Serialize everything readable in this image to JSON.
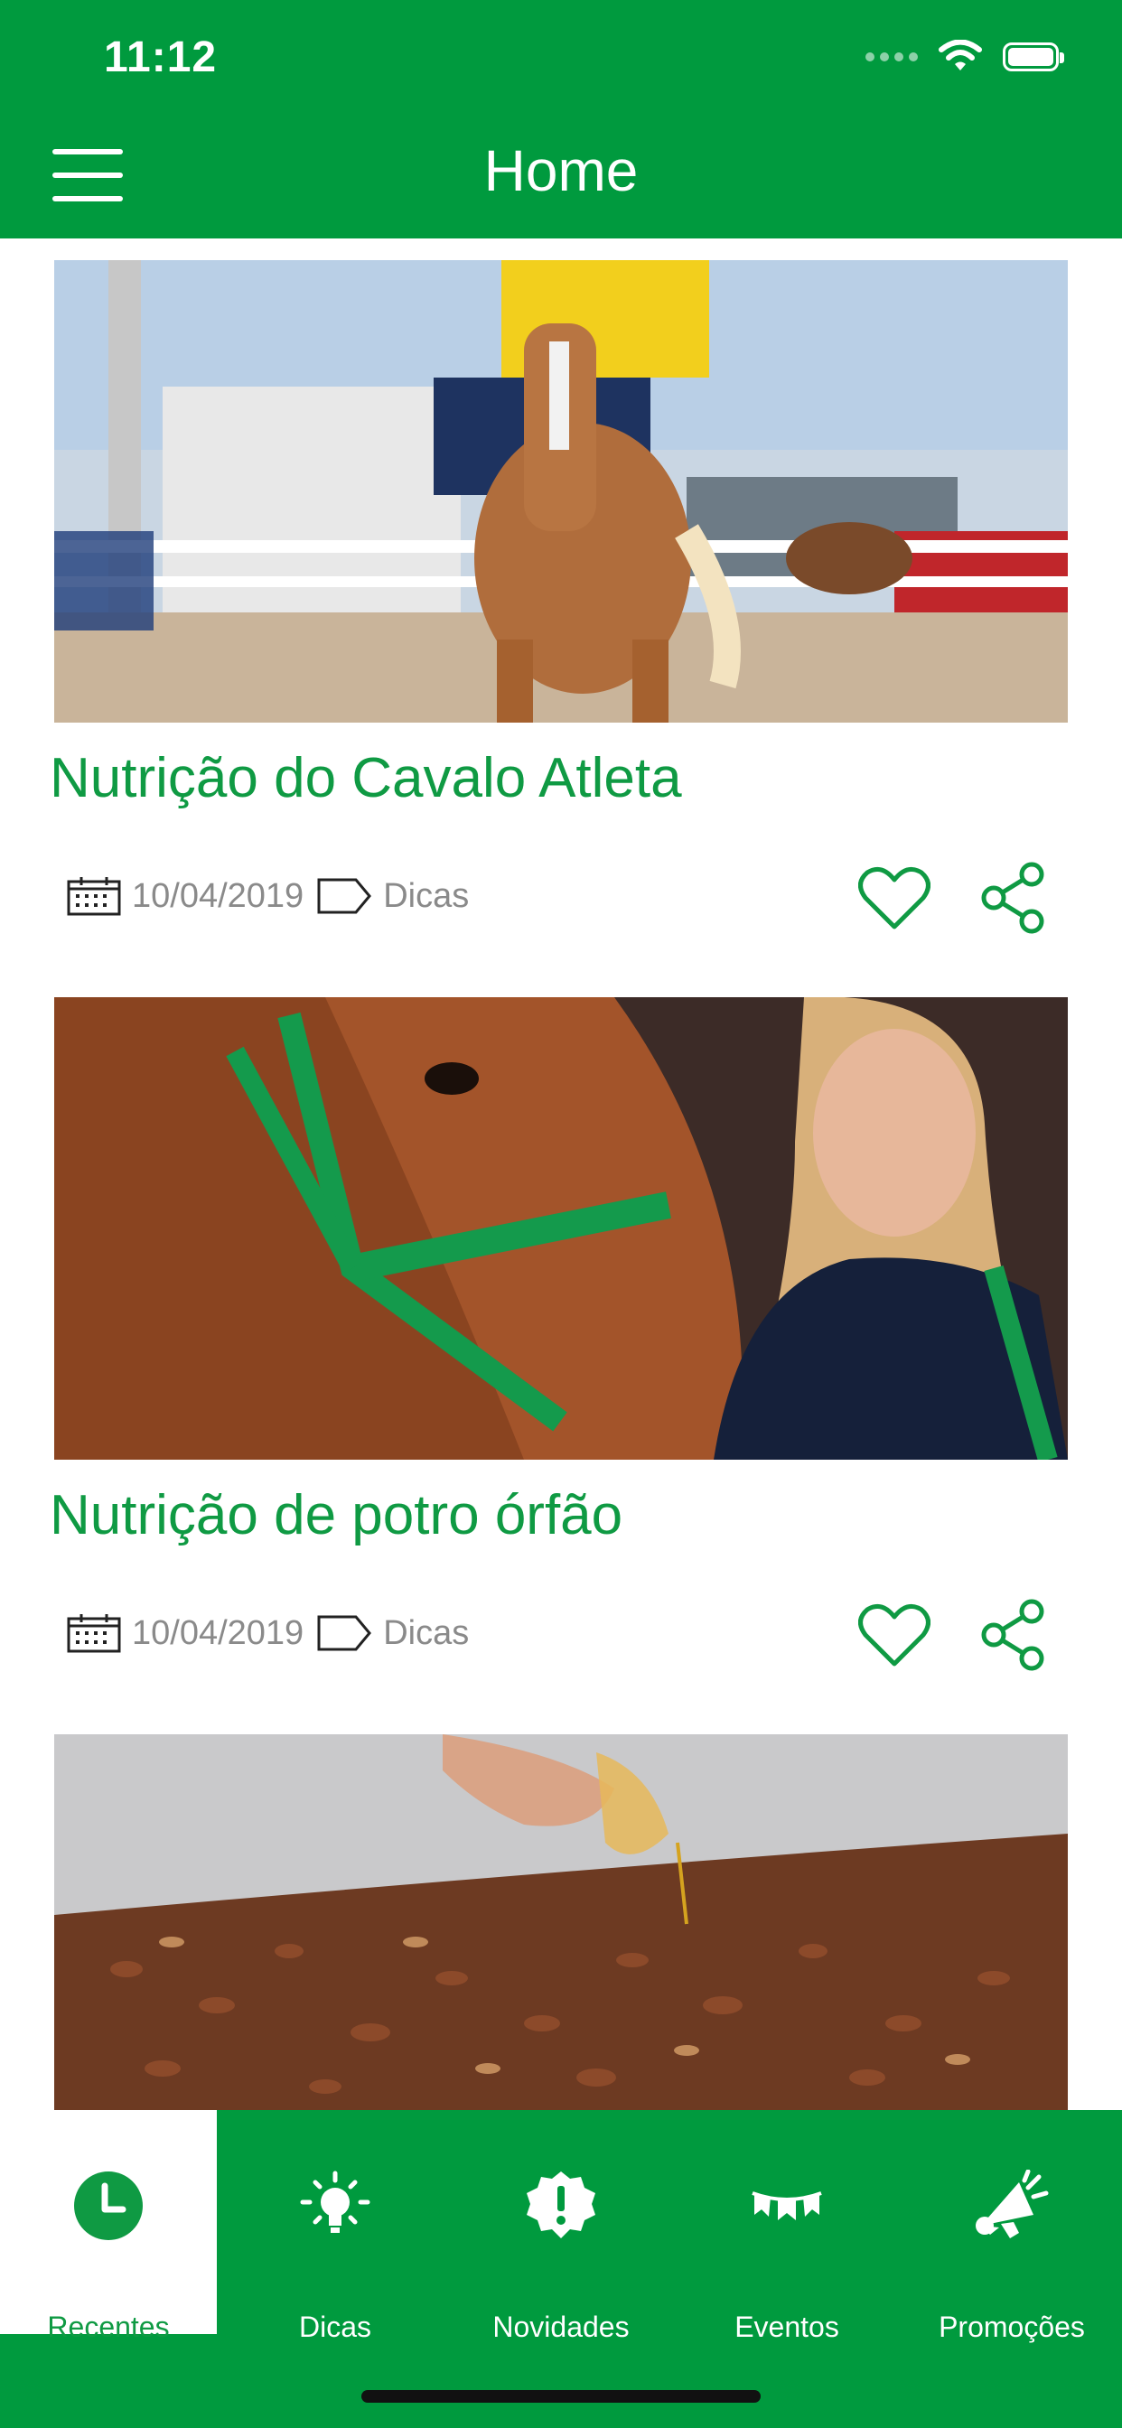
{
  "status_bar": {
    "time": "11:12"
  },
  "header": {
    "title": "Home"
  },
  "posts": [
    {
      "title": "Nutrição do Cavalo Atleta",
      "date": "10/04/2019",
      "category": "Dicas"
    },
    {
      "title": "Nutrição de potro órfão",
      "date": "10/04/2019",
      "category": "Dicas"
    },
    {
      "title": "",
      "date": "",
      "category": ""
    }
  ],
  "tabs": [
    {
      "label": "Recentes",
      "icon": "clock-icon",
      "active": true
    },
    {
      "label": "Dicas",
      "icon": "lightbulb-icon",
      "active": false
    },
    {
      "label": "Novidades",
      "icon": "exclamation-badge-icon",
      "active": false
    },
    {
      "label": "Eventos",
      "icon": "bunting-flags-icon",
      "active": false
    },
    {
      "label": "Promoções",
      "icon": "megaphone-icon",
      "active": false
    }
  ],
  "colors": {
    "brand_green": "#009a3e",
    "title_green": "#0f9a43",
    "meta_gray": "#8a8a8a"
  }
}
